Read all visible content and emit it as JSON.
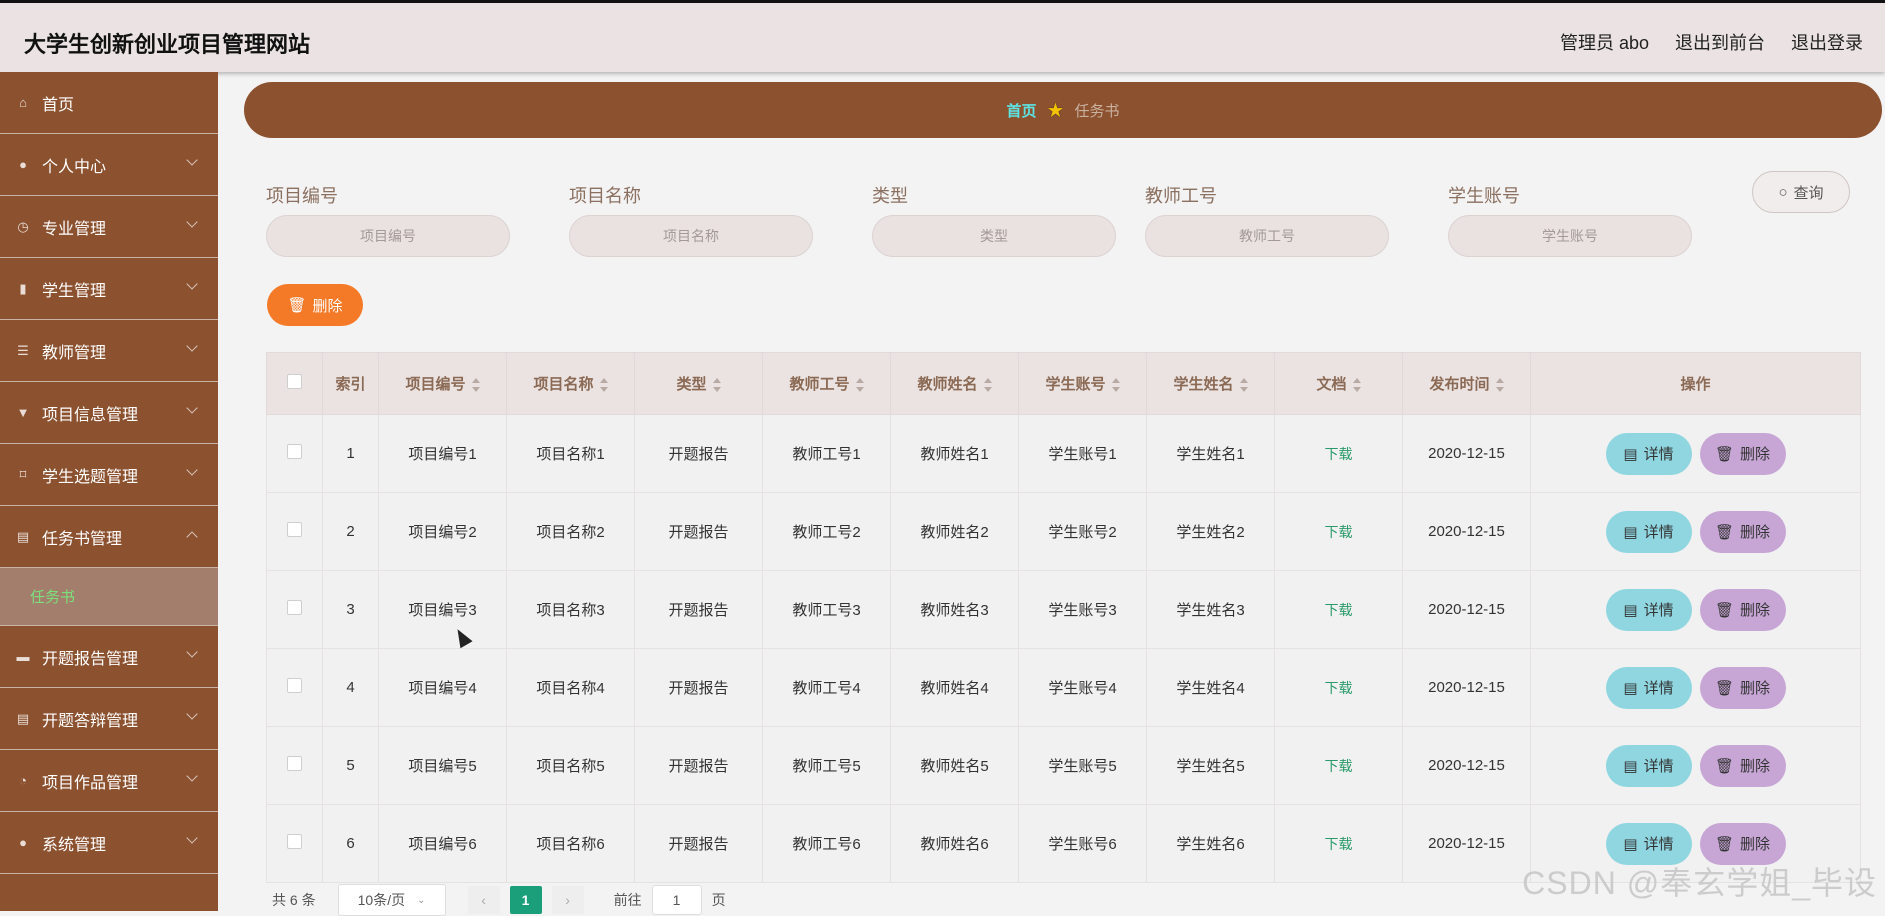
{
  "header": {
    "title": "大学生创新创业项目管理网站",
    "admin_label": "管理员 abo",
    "to_front": "退出到前台",
    "logout": "退出登录"
  },
  "sidebar": {
    "items": [
      {
        "label": "首页",
        "icon": "home-icon"
      },
      {
        "label": "个人中心",
        "icon": "user-icon"
      },
      {
        "label": "专业管理",
        "icon": "clock-icon"
      },
      {
        "label": "学生管理",
        "icon": "bar-chart-icon"
      },
      {
        "label": "教师管理",
        "icon": "list-icon"
      },
      {
        "label": "项目信息管理",
        "icon": "thumbtack-icon"
      },
      {
        "label": "学生选题管理",
        "icon": "crop-icon"
      },
      {
        "label": "任务书管理",
        "icon": "clipboard-icon"
      },
      {
        "label": "开题报告管理",
        "icon": "video-icon"
      },
      {
        "label": "开题答辩管理",
        "icon": "clipboard-icon"
      },
      {
        "label": "项目作品管理",
        "icon": "dashboard-icon"
      },
      {
        "label": "系统管理",
        "icon": "user-icon"
      }
    ],
    "sub_item": "任务书"
  },
  "breadcrumb": {
    "home": "首页",
    "current": "任务书"
  },
  "search": {
    "fields": [
      {
        "label": "项目编号",
        "placeholder": "项目编号"
      },
      {
        "label": "项目名称",
        "placeholder": "项目名称"
      },
      {
        "label": "类型",
        "placeholder": "类型"
      },
      {
        "label": "教师工号",
        "placeholder": "教师工号"
      },
      {
        "label": "学生账号",
        "placeholder": "学生账号"
      }
    ],
    "query_label": "查询"
  },
  "toolbar": {
    "delete_label": "删除"
  },
  "table": {
    "headers": [
      "索引",
      "项目编号",
      "项目名称",
      "类型",
      "教师工号",
      "教师姓名",
      "学生账号",
      "学生姓名",
      "文档",
      "发布时间",
      "操作"
    ],
    "rows": [
      {
        "index": "1",
        "code": "项目编号1",
        "name": "项目名称1",
        "type": "开题报告",
        "teacher_no": "教师工号1",
        "teacher_name": "教师姓名1",
        "student_no": "学生账号1",
        "student_name": "学生姓名1",
        "doc": "下载",
        "date": "2020-12-15"
      },
      {
        "index": "2",
        "code": "项目编号2",
        "name": "项目名称2",
        "type": "开题报告",
        "teacher_no": "教师工号2",
        "teacher_name": "教师姓名2",
        "student_no": "学生账号2",
        "student_name": "学生姓名2",
        "doc": "下载",
        "date": "2020-12-15"
      },
      {
        "index": "3",
        "code": "项目编号3",
        "name": "项目名称3",
        "type": "开题报告",
        "teacher_no": "教师工号3",
        "teacher_name": "教师姓名3",
        "student_no": "学生账号3",
        "student_name": "学生姓名3",
        "doc": "下载",
        "date": "2020-12-15"
      },
      {
        "index": "4",
        "code": "项目编号4",
        "name": "项目名称4",
        "type": "开题报告",
        "teacher_no": "教师工号4",
        "teacher_name": "教师姓名4",
        "student_no": "学生账号4",
        "student_name": "学生姓名4",
        "doc": "下载",
        "date": "2020-12-15"
      },
      {
        "index": "5",
        "code": "项目编号5",
        "name": "项目名称5",
        "type": "开题报告",
        "teacher_no": "教师工号5",
        "teacher_name": "教师姓名5",
        "student_no": "学生账号5",
        "student_name": "学生姓名5",
        "doc": "下载",
        "date": "2020-12-15"
      },
      {
        "index": "6",
        "code": "项目编号6",
        "name": "项目名称6",
        "type": "开题报告",
        "teacher_no": "教师工号6",
        "teacher_name": "教师姓名6",
        "student_no": "学生账号6",
        "student_name": "学生姓名6",
        "doc": "下载",
        "date": "2020-12-15"
      }
    ],
    "detail_label": "详情",
    "delete_label": "删除"
  },
  "pagination": {
    "total": "共 6 条",
    "page_size": "10条/页",
    "current_page": "1",
    "goto_prefix": "前往",
    "goto_value": "1",
    "goto_suffix": "页"
  },
  "watermark": "CSDN @奉玄学姐_毕设",
  "colors": {
    "sidebar": "#8c5230",
    "delete": "#f47a28",
    "detail": "#8fd6e0",
    "remove": "#c7a6d6",
    "page_active": "#1b9e7a"
  }
}
